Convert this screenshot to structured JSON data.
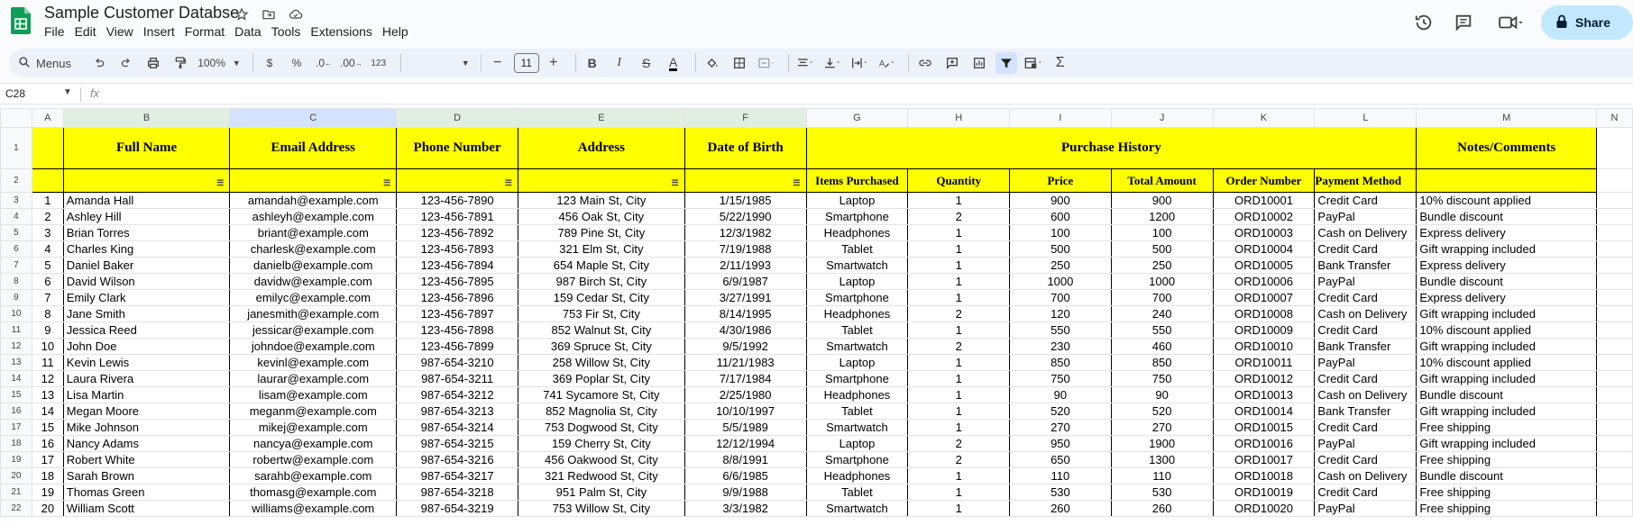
{
  "doc_title": "Sample Customer Databse",
  "menu": [
    "File",
    "Edit",
    "View",
    "Insert",
    "Format",
    "Data",
    "Tools",
    "Extensions",
    "Help"
  ],
  "share_label": "Share",
  "toolbar": {
    "menus_label": "Menus",
    "zoom": "100%",
    "currency": "$",
    "percent": "%",
    "dec_decrease": ".0",
    "dec_increase": ".00",
    "format_123": "123",
    "font_size": "11",
    "minus": "−",
    "plus": "+"
  },
  "name_box": "C28",
  "fx": "fx",
  "columns": [
    "A",
    "B",
    "C",
    "D",
    "E",
    "F",
    "G",
    "H",
    "I",
    "J",
    "K",
    "L",
    "M",
    "N"
  ],
  "header_row1": {
    "full_name": "Full Name",
    "email": "Email Address",
    "phone": "Phone Number",
    "address": "Address",
    "dob": "Date of Birth",
    "purchase_history": "Purchase History",
    "notes": "Notes/Comments"
  },
  "header_row2": {
    "items": "Items Purchased",
    "quantity": "Quantity",
    "price": "Price",
    "total": "Total Amount",
    "order": "Order Number",
    "payment": "Payment Method"
  },
  "rows": [
    {
      "n": "1",
      "name": "Amanda Hall",
      "email": "amandah@example.com",
      "phone": "123-456-7890",
      "address": "123 Main St, City",
      "dob": "1/15/1985",
      "item": "Laptop",
      "qty": "1",
      "price": "900",
      "total": "900",
      "order": "ORD10001",
      "pay": "Credit Card",
      "note": "10% discount applied"
    },
    {
      "n": "2",
      "name": "Ashley Hill",
      "email": "ashleyh@example.com",
      "phone": "123-456-7891",
      "address": "456 Oak St, City",
      "dob": "5/22/1990",
      "item": "Smartphone",
      "qty": "2",
      "price": "600",
      "total": "1200",
      "order": "ORD10002",
      "pay": "PayPal",
      "note": "Bundle discount"
    },
    {
      "n": "3",
      "name": "Brian Torres",
      "email": "briant@example.com",
      "phone": "123-456-7892",
      "address": "789 Pine St, City",
      "dob": "12/3/1982",
      "item": "Headphones",
      "qty": "1",
      "price": "100",
      "total": "100",
      "order": "ORD10003",
      "pay": "Cash on Delivery",
      "note": "Express delivery"
    },
    {
      "n": "4",
      "name": "Charles King",
      "email": "charlesk@example.com",
      "phone": "123-456-7893",
      "address": "321 Elm St, City",
      "dob": "7/19/1988",
      "item": "Tablet",
      "qty": "1",
      "price": "500",
      "total": "500",
      "order": "ORD10004",
      "pay": "Credit Card",
      "note": "Gift wrapping included"
    },
    {
      "n": "5",
      "name": "Daniel Baker",
      "email": "danielb@example.com",
      "phone": "123-456-7894",
      "address": "654 Maple St, City",
      "dob": "2/11/1993",
      "item": "Smartwatch",
      "qty": "1",
      "price": "250",
      "total": "250",
      "order": "ORD10005",
      "pay": "Bank Transfer",
      "note": "Express delivery"
    },
    {
      "n": "6",
      "name": "David Wilson",
      "email": "davidw@example.com",
      "phone": "123-456-7895",
      "address": "987 Birch St, City",
      "dob": "6/9/1987",
      "item": "Laptop",
      "qty": "1",
      "price": "1000",
      "total": "1000",
      "order": "ORD10006",
      "pay": "PayPal",
      "note": "Bundle discount"
    },
    {
      "n": "7",
      "name": "Emily Clark",
      "email": "emilyc@example.com",
      "phone": "123-456-7896",
      "address": "159 Cedar St, City",
      "dob": "3/27/1991",
      "item": "Smartphone",
      "qty": "1",
      "price": "700",
      "total": "700",
      "order": "ORD10007",
      "pay": "Credit Card",
      "note": "Express delivery"
    },
    {
      "n": "8",
      "name": "Jane Smith",
      "email": "janesmith@example.com",
      "phone": "123-456-7897",
      "address": "753 Fir St, City",
      "dob": "8/14/1995",
      "item": "Headphones",
      "qty": "2",
      "price": "120",
      "total": "240",
      "order": "ORD10008",
      "pay": "Cash on Delivery",
      "note": "Gift wrapping included"
    },
    {
      "n": "9",
      "name": "Jessica Reed",
      "email": "jessicar@example.com",
      "phone": "123-456-7898",
      "address": "852 Walnut St, City",
      "dob": "4/30/1986",
      "item": "Tablet",
      "qty": "1",
      "price": "550",
      "total": "550",
      "order": "ORD10009",
      "pay": "Credit Card",
      "note": "10% discount applied"
    },
    {
      "n": "10",
      "name": "John Doe",
      "email": "johndoe@example.com",
      "phone": "123-456-7899",
      "address": "369 Spruce St, City",
      "dob": "9/5/1992",
      "item": "Smartwatch",
      "qty": "2",
      "price": "230",
      "total": "460",
      "order": "ORD10010",
      "pay": "Bank Transfer",
      "note": "Gift wrapping included"
    },
    {
      "n": "11",
      "name": "Kevin Lewis",
      "email": "kevinl@example.com",
      "phone": "987-654-3210",
      "address": "258 Willow St, City",
      "dob": "11/21/1983",
      "item": "Laptop",
      "qty": "1",
      "price": "850",
      "total": "850",
      "order": "ORD10011",
      "pay": "PayPal",
      "note": "10% discount applied"
    },
    {
      "n": "12",
      "name": "Laura Rivera",
      "email": "laurar@example.com",
      "phone": "987-654-3211",
      "address": "369 Poplar St, City",
      "dob": "7/17/1984",
      "item": "Smartphone",
      "qty": "1",
      "price": "750",
      "total": "750",
      "order": "ORD10012",
      "pay": "Credit Card",
      "note": "Gift wrapping included"
    },
    {
      "n": "13",
      "name": "Lisa Martin",
      "email": "lisam@example.com",
      "phone": "987-654-3212",
      "address": "741 Sycamore St, City",
      "dob": "2/25/1980",
      "item": "Headphones",
      "qty": "1",
      "price": "90",
      "total": "90",
      "order": "ORD10013",
      "pay": "Cash on Delivery",
      "note": "Bundle discount"
    },
    {
      "n": "14",
      "name": "Megan Moore",
      "email": "meganm@example.com",
      "phone": "987-654-3213",
      "address": "852 Magnolia St, City",
      "dob": "10/10/1997",
      "item": "Tablet",
      "qty": "1",
      "price": "520",
      "total": "520",
      "order": "ORD10014",
      "pay": "Bank Transfer",
      "note": "Gift wrapping included"
    },
    {
      "n": "15",
      "name": "Mike Johnson",
      "email": "mikej@example.com",
      "phone": "987-654-3214",
      "address": "753 Dogwood St, City",
      "dob": "5/5/1989",
      "item": "Smartwatch",
      "qty": "1",
      "price": "270",
      "total": "270",
      "order": "ORD10015",
      "pay": "Credit Card",
      "note": "Free shipping"
    },
    {
      "n": "16",
      "name": "Nancy Adams",
      "email": "nancya@example.com",
      "phone": "987-654-3215",
      "address": "159 Cherry St, City",
      "dob": "12/12/1994",
      "item": "Laptop",
      "qty": "2",
      "price": "950",
      "total": "1900",
      "order": "ORD10016",
      "pay": "PayPal",
      "note": "Gift wrapping included"
    },
    {
      "n": "17",
      "name": "Robert White",
      "email": "robertw@example.com",
      "phone": "987-654-3216",
      "address": "456 Oakwood St, City",
      "dob": "8/8/1991",
      "item": "Smartphone",
      "qty": "2",
      "price": "650",
      "total": "1300",
      "order": "ORD10017",
      "pay": "Credit Card",
      "note": "Free shipping"
    },
    {
      "n": "18",
      "name": "Sarah Brown",
      "email": "sarahb@example.com",
      "phone": "987-654-3217",
      "address": "321 Redwood St, City",
      "dob": "6/6/1985",
      "item": "Headphones",
      "qty": "1",
      "price": "110",
      "total": "110",
      "order": "ORD10018",
      "pay": "Cash on Delivery",
      "note": "Bundle discount"
    },
    {
      "n": "19",
      "name": "Thomas Green",
      "email": "thomasg@example.com",
      "phone": "987-654-3218",
      "address": "951 Palm St, City",
      "dob": "9/9/1988",
      "item": "Tablet",
      "qty": "1",
      "price": "530",
      "total": "530",
      "order": "ORD10019",
      "pay": "Credit Card",
      "note": "Free shipping"
    },
    {
      "n": "20",
      "name": "William Scott",
      "email": "williams@example.com",
      "phone": "987-654-3219",
      "address": "753 Willow St, City",
      "dob": "3/3/1982",
      "item": "Smartwatch",
      "qty": "1",
      "price": "260",
      "total": "260",
      "order": "ORD10020",
      "pay": "PayPal",
      "note": "Free shipping"
    }
  ]
}
